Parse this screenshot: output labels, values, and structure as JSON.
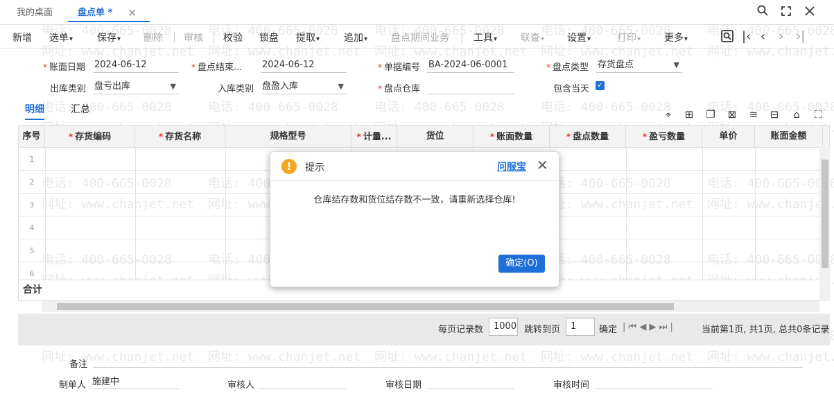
{
  "tabs": {
    "home": "我的桌面",
    "active": "盘点单 *",
    "close": "✕"
  },
  "toolbar": {
    "new": "新增",
    "select": "选单",
    "save": "保存",
    "delete": "删除",
    "audit": "审核",
    "verify": "校验",
    "lock": "锁盘",
    "fetch": "提取",
    "append": "追加",
    "period": "盘点期间业务",
    "tools": "工具",
    "query": "联查",
    "settings": "设置",
    "print": "打印",
    "more": "更多"
  },
  "form": {
    "account_date_label": "账面日期",
    "account_date": "2024-06-12",
    "end_label": "盘点结束...",
    "end_date": "2024-06-12",
    "doc_no_label": "单据编号",
    "doc_no": "BA-2024-06-0001",
    "type_label": "盘点类型",
    "type": "存货盘点",
    "out_label": "出库类别",
    "out_value": "盘亏出库",
    "in_label": "入库类别",
    "in_value": "盘盈入库",
    "warehouse_label": "盘点仓库",
    "warehouse": "",
    "include_today_label": "包含当天",
    "include_today_checked": true
  },
  "subtabs": {
    "detail": "明细",
    "summary": "汇总"
  },
  "grid": {
    "columns": [
      "序号",
      "存货编码",
      "存货名称",
      "规格型号",
      "计量...",
      "货位",
      "账面数量",
      "盘点数量",
      "盈亏数量",
      "单价",
      "账面金额"
    ],
    "required": [
      false,
      true,
      true,
      false,
      true,
      false,
      true,
      true,
      true,
      false,
      false
    ],
    "rows": [
      "1",
      "2",
      "3",
      "4",
      "5",
      "6"
    ],
    "total_label": "合计"
  },
  "pager": {
    "per_page_label": "每页记录数",
    "per_page": "1000",
    "jump_label": "跳转到页",
    "jump_value": "1",
    "confirm": "确定",
    "status": "当前第1页, 共1页, 总共0条记录"
  },
  "footer": {
    "remark_label": "备注",
    "maker_label": "制单人",
    "maker": "施建中",
    "auditor_label": "审核人",
    "audit_date_label": "审核日期",
    "audit_time_label": "审核时间"
  },
  "dialog": {
    "title": "提示",
    "help": "问服宝",
    "close": "✕",
    "message": "仓库结存数和货位结存数不一致，请重新选择仓库!",
    "ok": "确定(O)"
  },
  "watermark": {
    "phone": "电话: 400-665-0028",
    "site": "网址: www.chanjet.net"
  },
  "colors": {
    "accent": "#1e6fd6",
    "warning": "#f5a623",
    "required": "#e33333"
  }
}
